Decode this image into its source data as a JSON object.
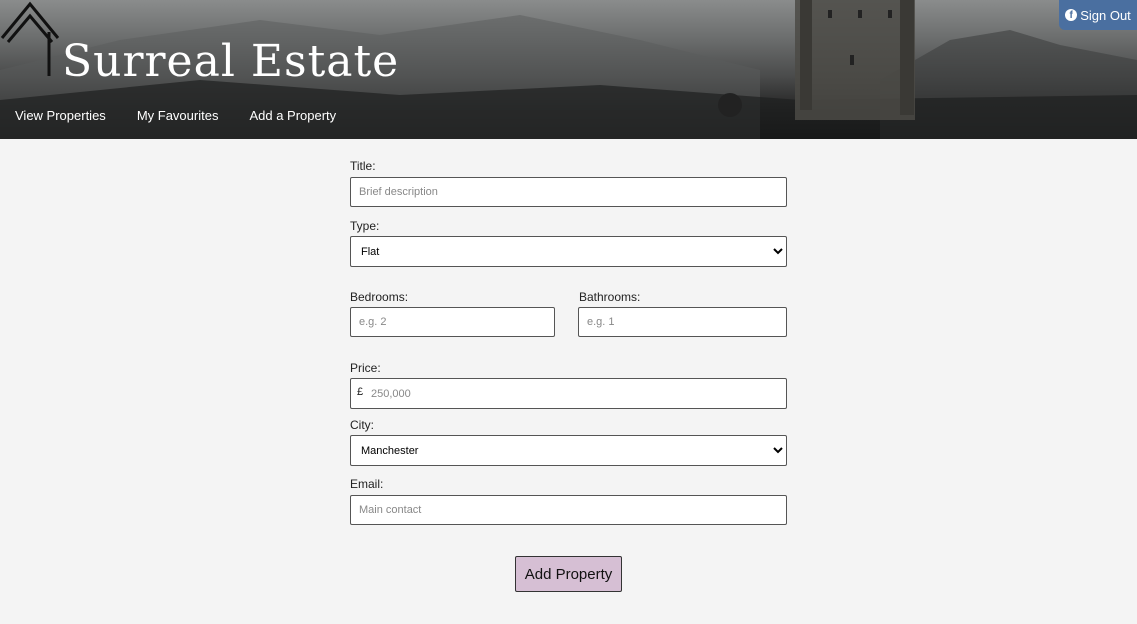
{
  "header": {
    "brand": "Surreal Estate",
    "nav": [
      "View Properties",
      "My Favourites",
      "Add a Property"
    ],
    "signout_label": "Sign Out"
  },
  "form": {
    "title": {
      "label": "Title:",
      "placeholder": "Brief description"
    },
    "type": {
      "label": "Type:",
      "value": "Flat"
    },
    "bedrooms": {
      "label": "Bedrooms:",
      "placeholder": "e.g. 2"
    },
    "bathrooms": {
      "label": "Bathrooms:",
      "placeholder": "e.g. 1"
    },
    "price": {
      "label": "Price:",
      "currency": "£",
      "placeholder": "250,000"
    },
    "city": {
      "label": "City:",
      "value": "Manchester"
    },
    "email": {
      "label": "Email:",
      "placeholder": "Main contact"
    },
    "submit_label": "Add Property"
  },
  "colors": {
    "signout_bg": "#4a6fa0",
    "submit_bg": "#d6bfd4",
    "page_bg": "#f4f4f4"
  }
}
